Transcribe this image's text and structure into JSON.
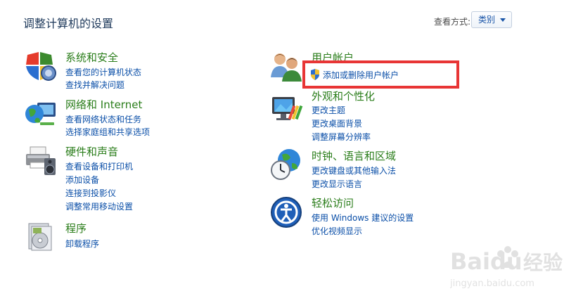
{
  "header": {
    "title": "调整计算机的设置",
    "view_by_label": "查看方式:",
    "view_by_value": "类别"
  },
  "categories": [
    {
      "title": "系统和安全",
      "links": [
        "查看您的计算机状态",
        "查找并解决问题"
      ]
    },
    {
      "title": "网络和 Internet",
      "links": [
        "查看网络状态和任务",
        "选择家庭组和共享选项"
      ]
    },
    {
      "title": "硬件和声音",
      "links": [
        "查看设备和打印机",
        "添加设备",
        "连接到投影仪",
        "调整常用移动设置"
      ]
    },
    {
      "title": "程序",
      "links": [
        "卸载程序"
      ]
    },
    {
      "title": "用户帐户",
      "links": [
        "添加或删除用户帐户"
      ]
    },
    {
      "title": "外观和个性化",
      "links": [
        "更改主题",
        "更改桌面背景",
        "调整屏幕分辨率"
      ]
    },
    {
      "title": "时钟、语言和区域",
      "links": [
        "更改键盘或其他输入法",
        "更改显示语言"
      ]
    },
    {
      "title": "轻松访问",
      "links": [
        "使用 Windows 建议的设置",
        "优化视频显示"
      ]
    }
  ],
  "watermark": {
    "brand": "Baidu",
    "brand_cn": "经验",
    "url": "jingyan.baidu.com"
  },
  "colors": {
    "title": "#1e395b",
    "category": "#2a7d1a",
    "link": "#0b4fa8",
    "highlight": "#e83535"
  }
}
